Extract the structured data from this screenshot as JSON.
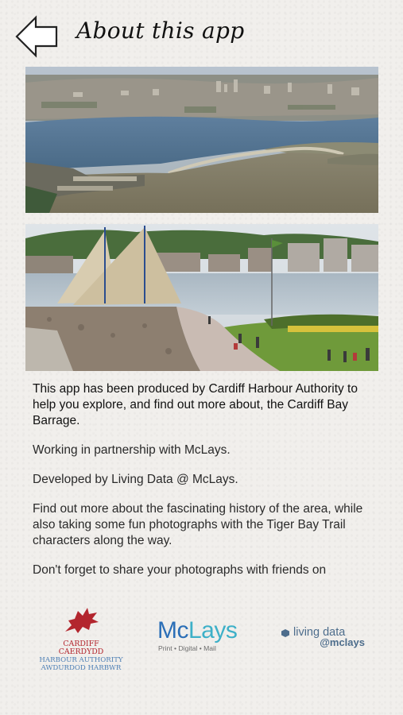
{
  "header": {
    "title": "About this app",
    "back_icon": "back-arrow-icon"
  },
  "photos": [
    {
      "name": "aerial-photo-cardiff-bay"
    },
    {
      "name": "barrage-walkway-photo"
    }
  ],
  "body": {
    "paragraphs": [
      "This app has been produced by Cardiff Harbour Authority to help you explore, and find out more about, the Cardiff Bay Barrage.",
      "Working in partnership with McLays.",
      "Developed by Living Data @ McLays.",
      "Find out more about the fascinating history of the area, while also taking some fun photographs with the Tiger Bay Trail characters along the way.",
      "Don't forget to share your photographs with friends on"
    ]
  },
  "logos": {
    "cardiff": {
      "line1": "CARDIFF",
      "line2": "CAERDYDD",
      "line3": "HARBOUR AUTHORITY",
      "line4": "AWDURDOD HARBWR",
      "color_red": "#b3262e",
      "color_blue": "#4d7fb5"
    },
    "mclays": {
      "word_mc": "Mc",
      "word_lays": "Lays",
      "tagline": "Print • Digital • Mail",
      "color": "#2c6fb7"
    },
    "living_data": {
      "line1": "living data",
      "line2": "@mclays",
      "color": "#4d6d8c"
    }
  }
}
